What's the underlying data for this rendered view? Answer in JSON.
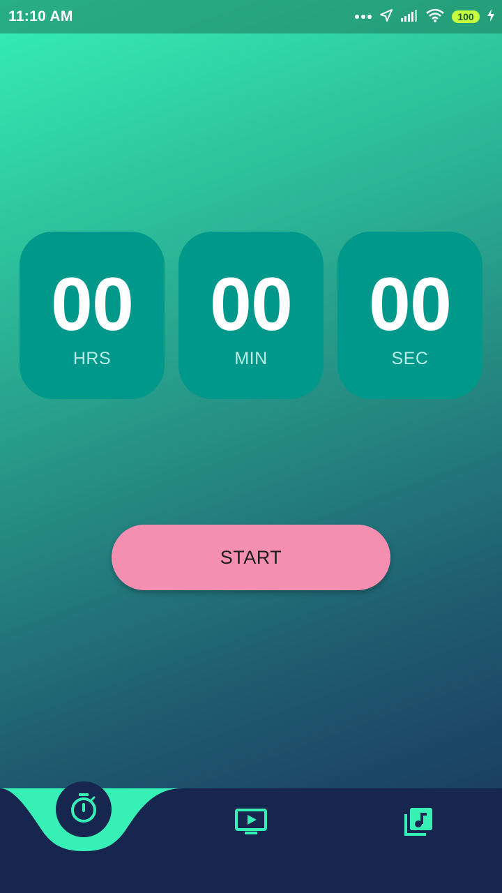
{
  "status_bar": {
    "time": "11:10 AM",
    "battery": "100",
    "icons": [
      "more-dots-icon",
      "location-arrow-icon",
      "signal-icon",
      "wifi-icon",
      "battery-icon",
      "charging-bolt-icon"
    ]
  },
  "timer": {
    "hours": {
      "value": "00",
      "unit": "HRS"
    },
    "minutes": {
      "value": "00",
      "unit": "MIN"
    },
    "seconds": {
      "value": "00",
      "unit": "SEC"
    }
  },
  "start_button": {
    "label": "START"
  },
  "bottom_nav": {
    "items": [
      {
        "icon": "stopwatch-icon",
        "active": true
      },
      {
        "icon": "video-play-icon",
        "active": false
      },
      {
        "icon": "music-library-icon",
        "active": false
      }
    ]
  },
  "colors": {
    "accent": "#36f0b6",
    "card": "#00988a",
    "button": "#f48fb1",
    "nav_background": "#17264f"
  }
}
